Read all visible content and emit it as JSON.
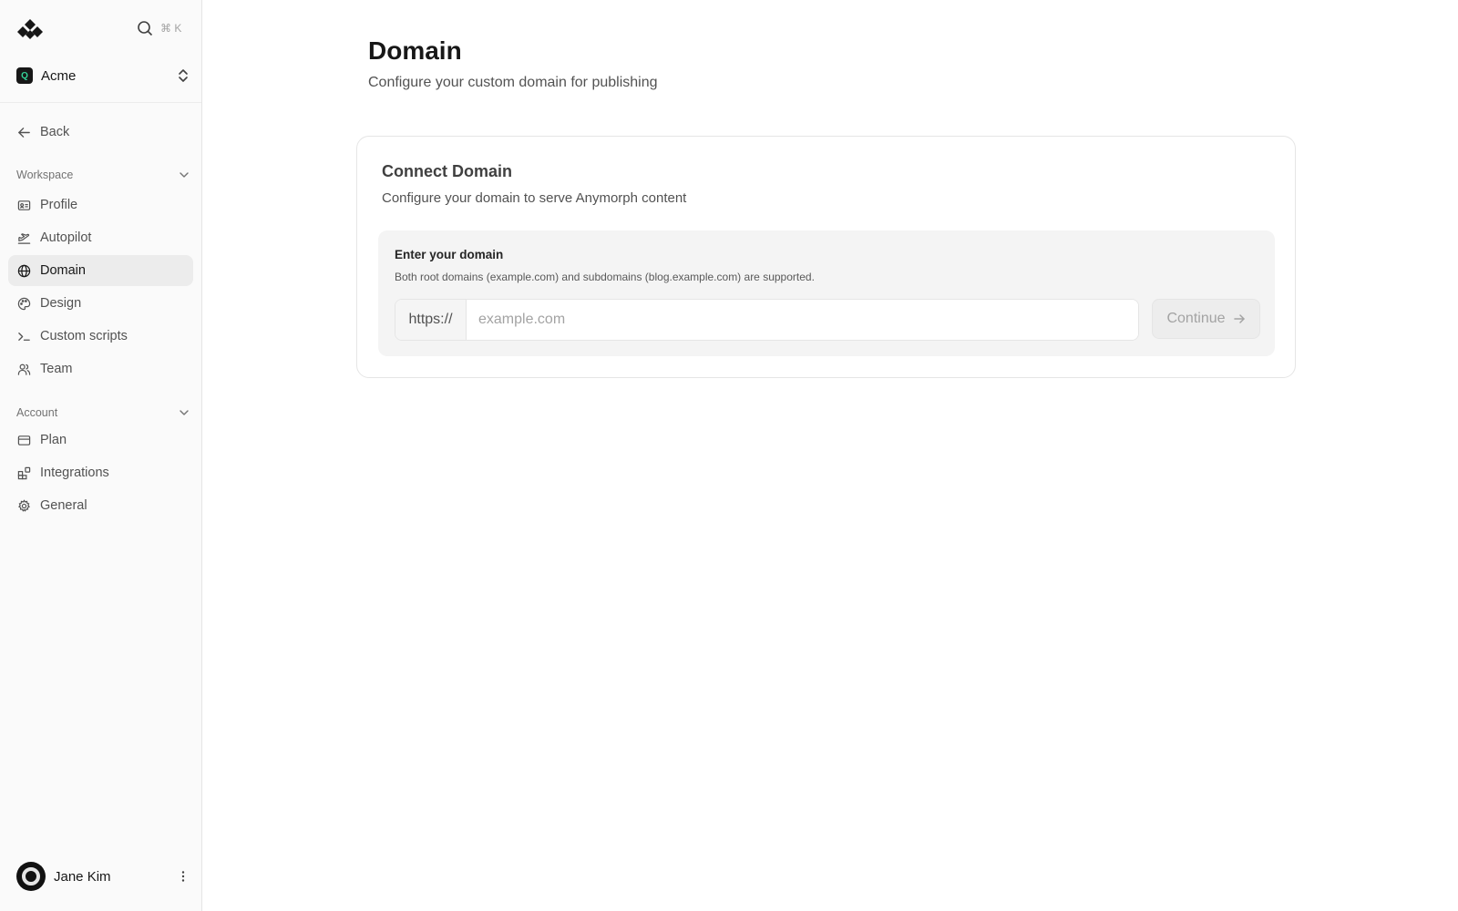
{
  "search": {
    "shortcut": "⌘ K"
  },
  "workspace": {
    "badge": "Q",
    "name": "Acme"
  },
  "nav": {
    "back_label": "Back",
    "workspace_section": "Workspace",
    "workspace_items": [
      {
        "label": "Profile",
        "icon": "id-card-icon"
      },
      {
        "label": "Autopilot",
        "icon": "autopilot-icon"
      },
      {
        "label": "Domain",
        "icon": "globe-icon",
        "active": true
      },
      {
        "label": "Design",
        "icon": "palette-icon"
      },
      {
        "label": "Custom scripts",
        "icon": "terminal-icon"
      },
      {
        "label": "Team",
        "icon": "users-icon"
      }
    ],
    "account_section": "Account",
    "account_items": [
      {
        "label": "Plan",
        "icon": "credit-card-icon"
      },
      {
        "label": "Integrations",
        "icon": "blocks-icon"
      },
      {
        "label": "General",
        "icon": "gear-icon"
      }
    ]
  },
  "user": {
    "name": "Jane Kim"
  },
  "page": {
    "title": "Domain",
    "subtitle": "Configure your custom domain for publishing"
  },
  "card": {
    "title": "Connect Domain",
    "description": "Configure your domain to serve Anymorph content",
    "field_label": "Enter your domain",
    "field_hint": "Both root domains (example.com) and subdomains (blog.example.com) are supported.",
    "url_prefix": "https://",
    "input_value": "",
    "input_placeholder": "example.com",
    "continue_label": "Continue"
  }
}
